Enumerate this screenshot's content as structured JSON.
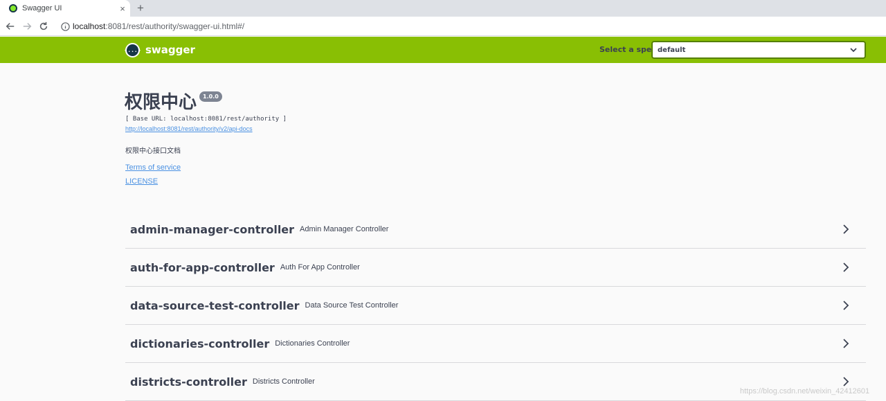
{
  "browser": {
    "tab_title": "Swagger UI",
    "tab_close": "×",
    "new_tab": "+",
    "url_host": "localhost",
    "url_rest": ":8081/rest/authority/swagger-ui.html#/"
  },
  "topbar": {
    "logo_glyph": "{...}",
    "logo_text": "swagger",
    "spec_label": "Select a spec",
    "spec_value": "default",
    "brand_color": "#89bf04"
  },
  "info": {
    "title": "权限中心",
    "version": "1.0.0",
    "base_url": "[ Base URL: localhost:8081/rest/authority ]",
    "docs_url": "http://localhost:8081/rest/authority/v2/api-docs",
    "description": "权限中心接口文档",
    "terms_label": "Terms of service",
    "license_label": "LICENSE"
  },
  "controllers": [
    {
      "name": "admin-manager-controller",
      "description": "Admin Manager Controller"
    },
    {
      "name": "auth-for-app-controller",
      "description": "Auth For App Controller"
    },
    {
      "name": "data-source-test-controller",
      "description": "Data Source Test Controller"
    },
    {
      "name": "dictionaries-controller",
      "description": "Dictionaries Controller"
    },
    {
      "name": "districts-controller",
      "description": "Districts Controller"
    }
  ],
  "watermark": "https://blog.csdn.net/weixin_42412601"
}
